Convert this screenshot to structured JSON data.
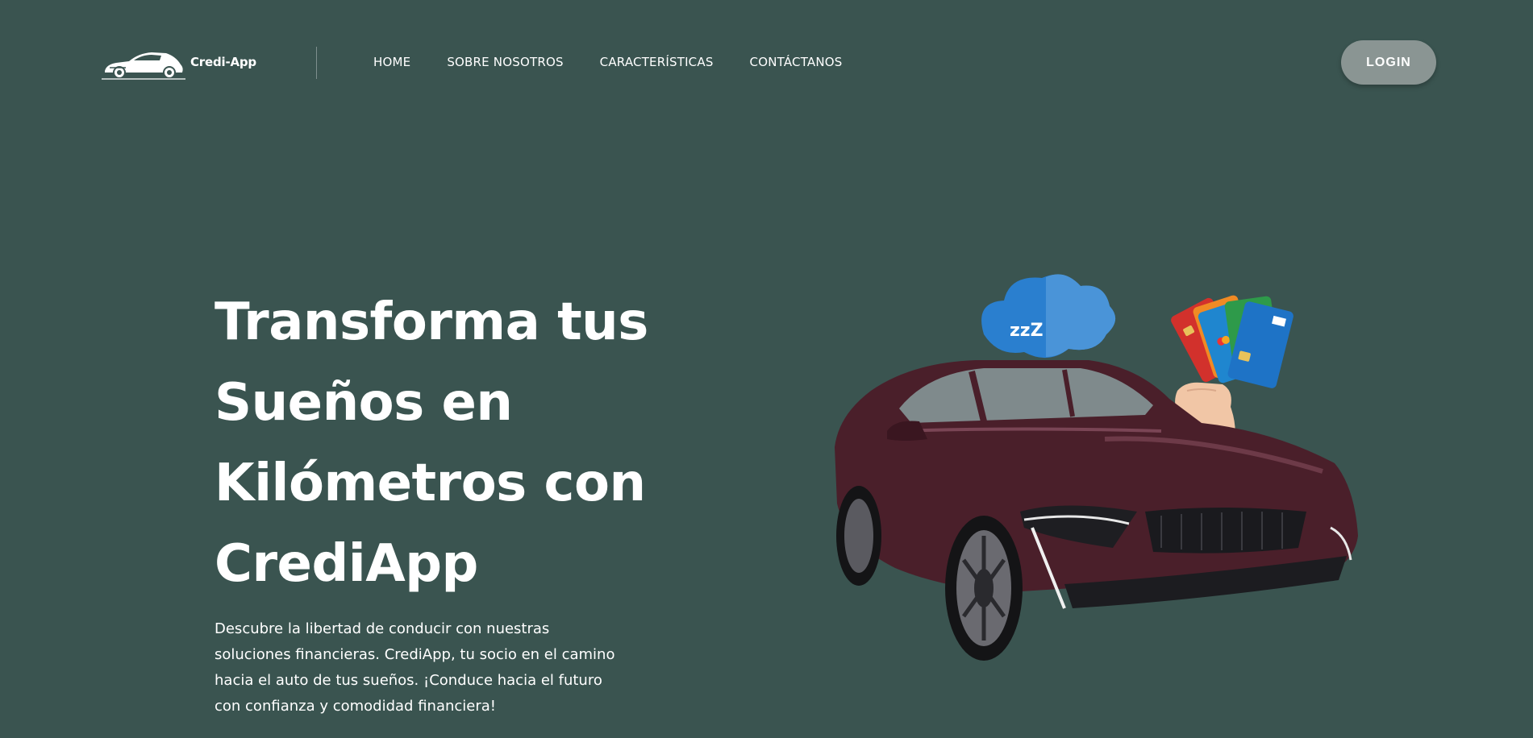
{
  "header": {
    "logo_text": "Credi-App",
    "nav": [
      {
        "label": "HOME"
      },
      {
        "label": "SOBRE NOSOTROS"
      },
      {
        "label": "CARACTERÍSTICAS"
      },
      {
        "label": "CONTÁCTANOS"
      }
    ],
    "login_label": "LOGIN"
  },
  "hero": {
    "title_lines": [
      "Transforma tus",
      "Sueños en",
      "Kilómetros con",
      "CrediApp"
    ],
    "description": "Descubre la libertad de conducir con nuestras soluciones financieras. CrediApp, tu socio en el camino hacia el auto de tus sueños. ¡Conduce hacia el futuro con confianza y comodidad financiera!",
    "thought_text": "zzZ"
  },
  "colors": {
    "background": "#3a5450",
    "login_button": "#8a9593",
    "car_body": "#4a1f2a",
    "cloud_blue": "#2a7fcf"
  },
  "icons": {
    "logo": "car-logo-icon",
    "illustration": "car-with-credit-cards-illustration"
  }
}
